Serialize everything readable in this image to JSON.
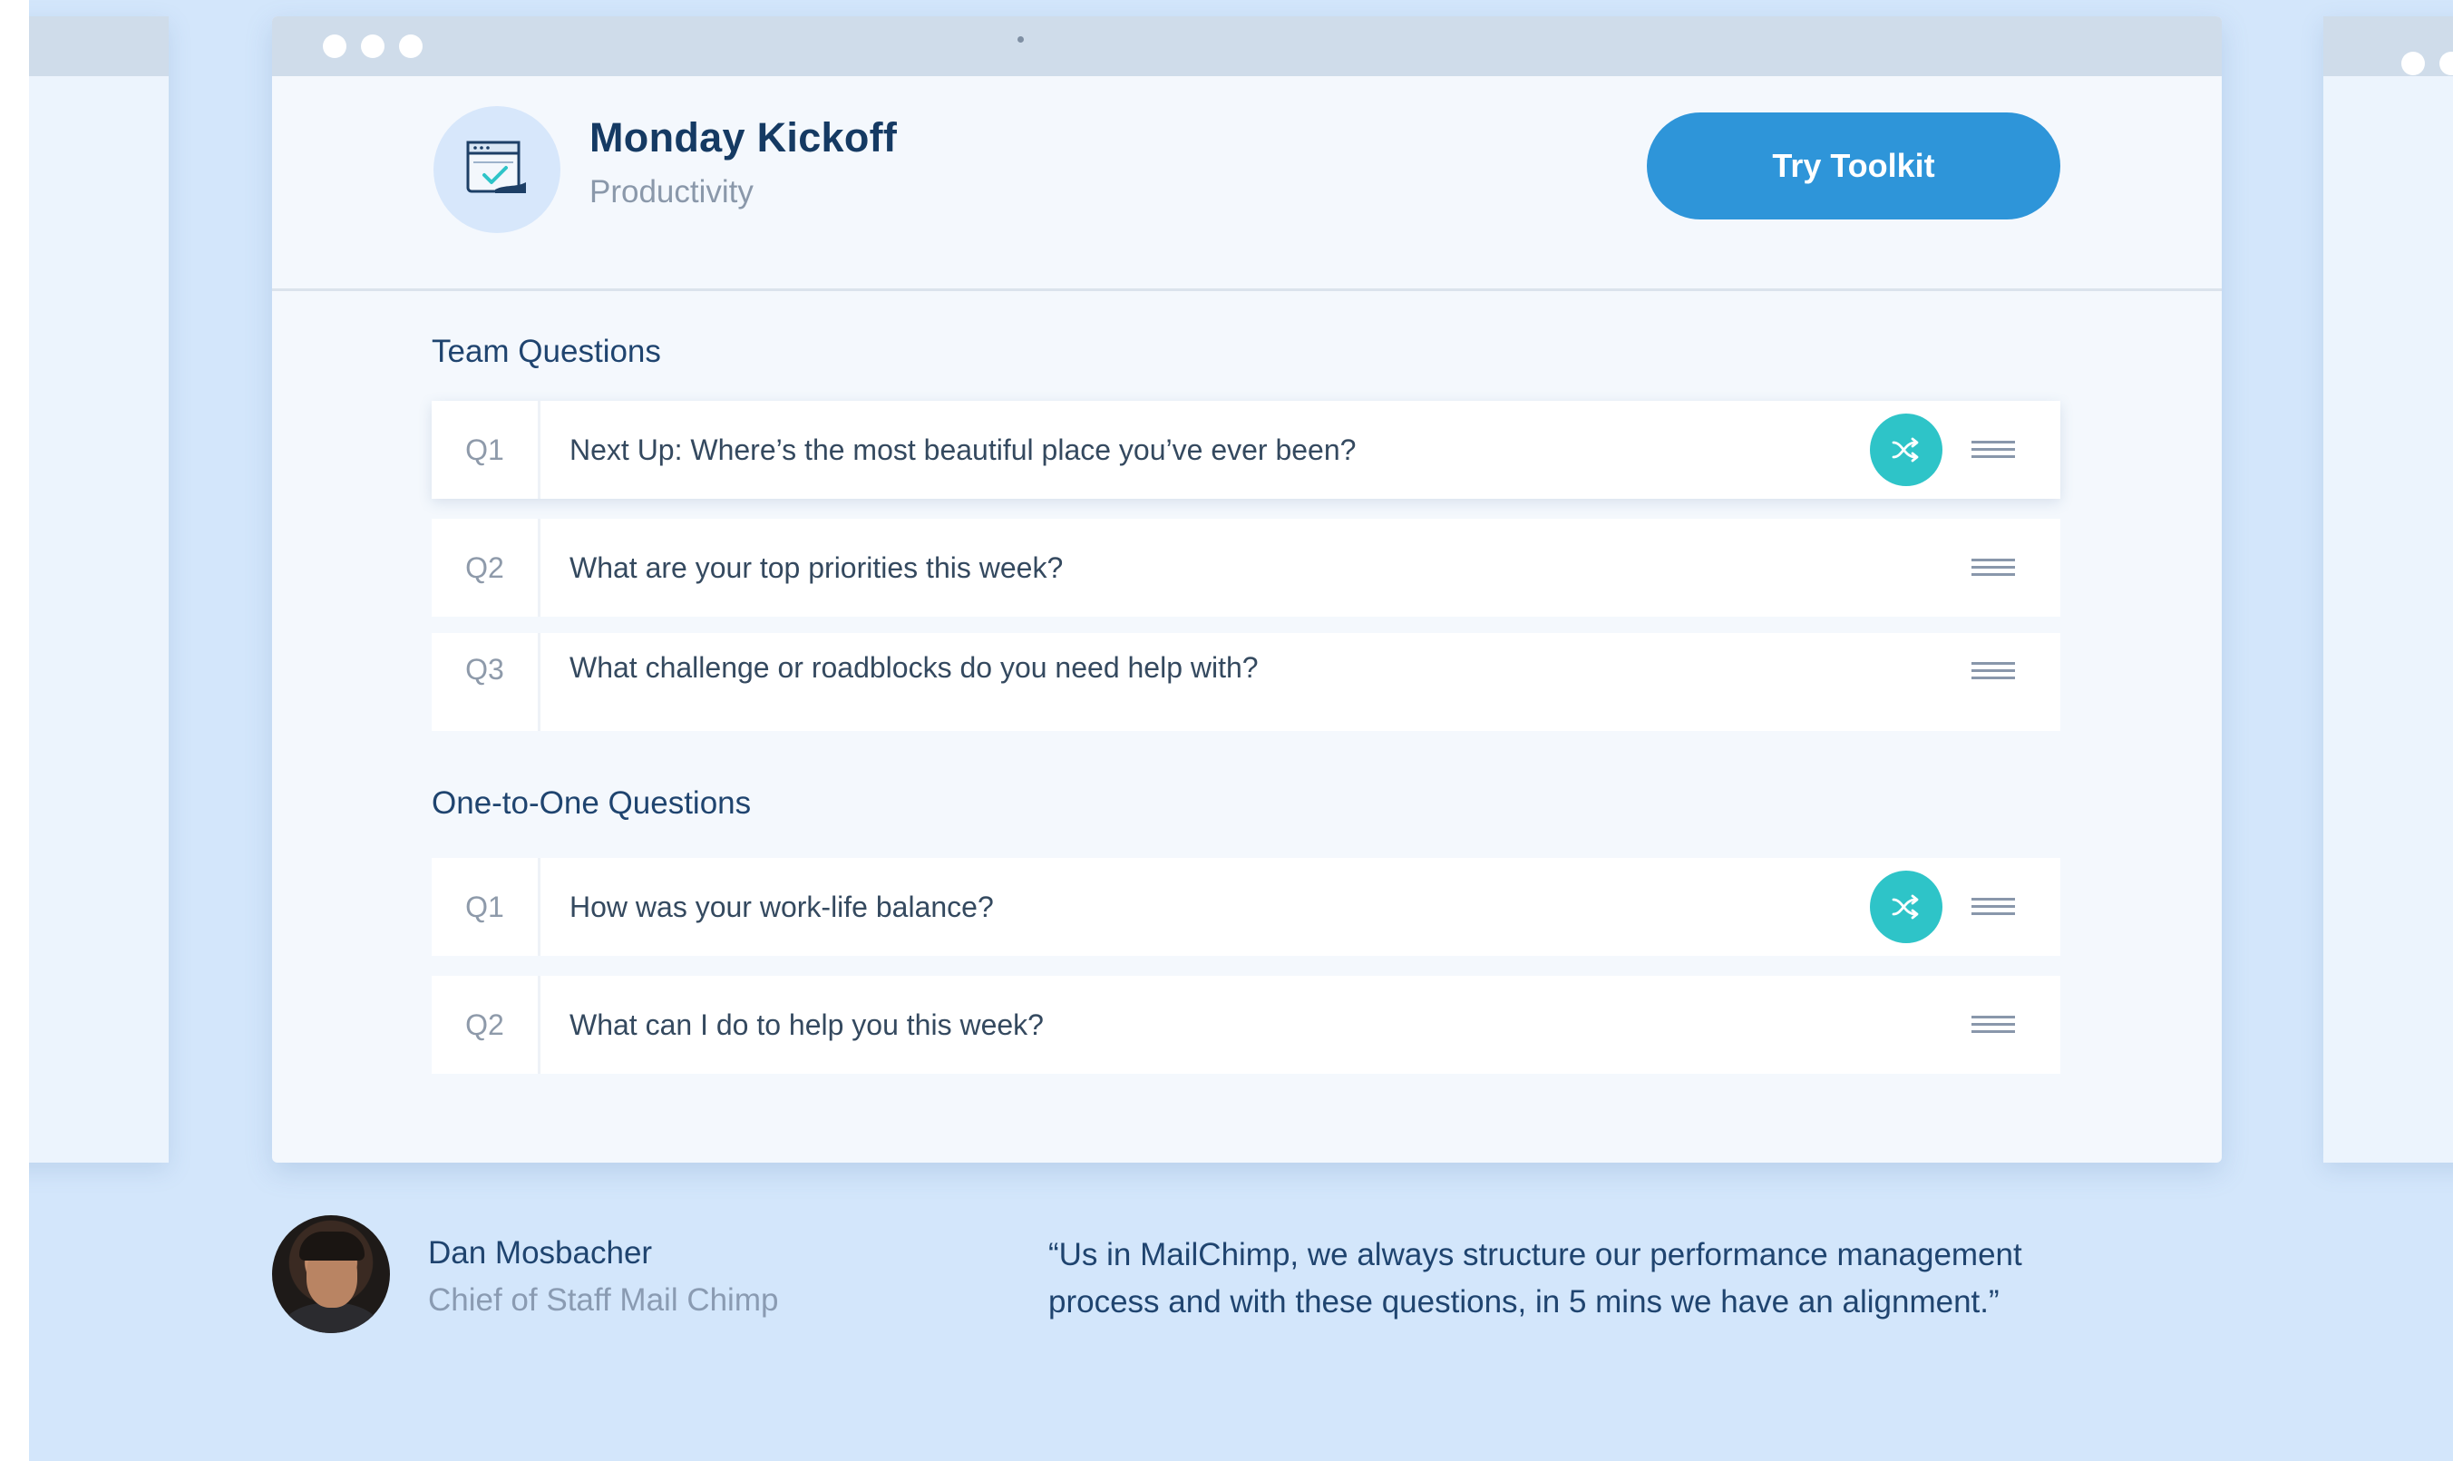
{
  "toolkit": {
    "title": "Monday Kickoff",
    "category": "Productivity",
    "cta_label": "Try Toolkit"
  },
  "team_questions": {
    "title": "Team Questions",
    "items": [
      {
        "num": "Q1",
        "text": "Next Up: Where’s the most beautiful place you’ve ever been?",
        "shuffle": true,
        "active": true
      },
      {
        "num": "Q2",
        "text": "What are your top priorities this week?",
        "shuffle": false,
        "active": false
      },
      {
        "num": "Q3",
        "text": "What challenge or roadblocks do you need help with?",
        "shuffle": false,
        "active": false
      }
    ]
  },
  "one_to_one_questions": {
    "title": "One-to-One Questions",
    "items": [
      {
        "num": "Q1",
        "text": "How was your work-life balance?",
        "shuffle": true,
        "active": false
      },
      {
        "num": "Q2",
        "text": "What can I do to help you this week?",
        "shuffle": false,
        "active": false
      }
    ]
  },
  "testimonial": {
    "name": "Dan Mosbacher",
    "role": "Chief of Staff Mail Chimp",
    "quote": "“Us in MailChimp, we always structure our performance management process and with these questions, in 5 mins we have an alignment.”"
  },
  "colors": {
    "background": "#d3e6fb",
    "primary_button": "#2e95d9",
    "shuffle_button": "#2ec4c8",
    "heading": "#153a63"
  },
  "icons": {
    "app": "calendar-check-icon",
    "shuffle": "shuffle-icon",
    "drag": "drag-handle-icon"
  }
}
